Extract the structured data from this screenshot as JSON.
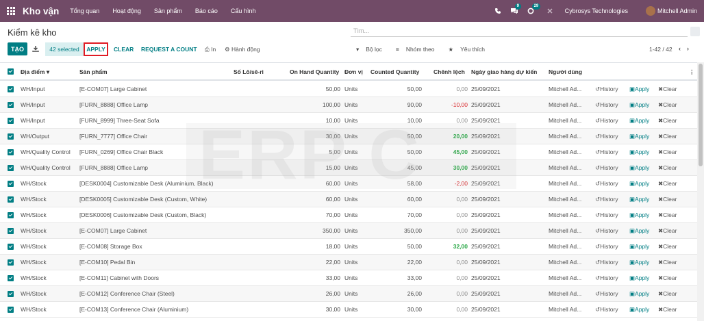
{
  "navbar": {
    "brand": "Kho vận",
    "menu": [
      "Tổng quan",
      "Hoạt động",
      "Sản phẩm",
      "Báo cáo",
      "Cấu hình"
    ],
    "chat_badge": "9",
    "activity_badge": "29",
    "company": "Cybrosys Technologies",
    "user": "Mitchell Admin",
    "color": "#714b67"
  },
  "control": {
    "title": "Kiểm kê kho",
    "search_placeholder": "Tìm...",
    "create": "TẠO",
    "selected": "42 selected",
    "apply": "APPLY",
    "clear": "CLEAR",
    "request_count": "REQUEST A COUNT",
    "print": "In",
    "action": "Hành động",
    "filters": "Bộ lọc",
    "group_by": "Nhóm theo",
    "favorites": "Yêu thích",
    "pager": "1-42 / 42",
    "accent": "#017e84"
  },
  "columns": [
    "Địa điểm",
    "Sản phẩm",
    "Số Lô/sê-ri",
    "On Hand Quantity",
    "Đơn vị",
    "Counted Quantity",
    "Chênh lệch",
    "Ngày giao hàng dự kiến",
    "Người dùng"
  ],
  "row_actions": {
    "history": "History",
    "apply": "Apply",
    "clear": "Clear"
  },
  "rows": [
    {
      "location": "WH/Input",
      "product": "[E-COM07] Large Cabinet",
      "on_hand": "50,00",
      "uom": "Units",
      "counted": "50,00",
      "diff": "0,00",
      "date": "25/09/2021",
      "user": "Mitchell Ad..."
    },
    {
      "location": "WH/Input",
      "product": "[FURN_8888] Office Lamp",
      "on_hand": "100,00",
      "uom": "Units",
      "counted": "90,00",
      "diff": "-10,00",
      "date": "25/09/2021",
      "user": "Mitchell Ad..."
    },
    {
      "location": "WH/Input",
      "product": "[FURN_8999] Three-Seat Sofa",
      "on_hand": "10,00",
      "uom": "Units",
      "counted": "10,00",
      "diff": "0,00",
      "date": "25/09/2021",
      "user": "Mitchell Ad..."
    },
    {
      "location": "WH/Output",
      "product": "[FURN_7777] Office Chair",
      "on_hand": "30,00",
      "uom": "Units",
      "counted": "50,00",
      "diff": "20,00",
      "date": "25/09/2021",
      "user": "Mitchell Ad..."
    },
    {
      "location": "WH/Quality Control",
      "product": "[FURN_0269] Office Chair Black",
      "on_hand": "5,00",
      "uom": "Units",
      "counted": "50,00",
      "diff": "45,00",
      "date": "25/09/2021",
      "user": "Mitchell Ad..."
    },
    {
      "location": "WH/Quality Control",
      "product": "[FURN_8888] Office Lamp",
      "on_hand": "15,00",
      "uom": "Units",
      "counted": "45,00",
      "diff": "30,00",
      "date": "25/09/2021",
      "user": "Mitchell Ad..."
    },
    {
      "location": "WH/Stock",
      "product": "[DESK0004] Customizable Desk (Aluminium, Black)",
      "on_hand": "60,00",
      "uom": "Units",
      "counted": "58,00",
      "diff": "-2,00",
      "date": "25/09/2021",
      "user": "Mitchell Ad..."
    },
    {
      "location": "WH/Stock",
      "product": "[DESK0005] Customizable Desk (Custom, White)",
      "on_hand": "60,00",
      "uom": "Units",
      "counted": "60,00",
      "diff": "0,00",
      "date": "25/09/2021",
      "user": "Mitchell Ad..."
    },
    {
      "location": "WH/Stock",
      "product": "[DESK0006] Customizable Desk (Custom, Black)",
      "on_hand": "70,00",
      "uom": "Units",
      "counted": "70,00",
      "diff": "0,00",
      "date": "25/09/2021",
      "user": "Mitchell Ad..."
    },
    {
      "location": "WH/Stock",
      "product": "[E-COM07] Large Cabinet",
      "on_hand": "350,00",
      "uom": "Units",
      "counted": "350,00",
      "diff": "0,00",
      "date": "25/09/2021",
      "user": "Mitchell Ad..."
    },
    {
      "location": "WH/Stock",
      "product": "[E-COM08] Storage Box",
      "on_hand": "18,00",
      "uom": "Units",
      "counted": "50,00",
      "diff": "32,00",
      "date": "25/09/2021",
      "user": "Mitchell Ad..."
    },
    {
      "location": "WH/Stock",
      "product": "[E-COM10] Pedal Bin",
      "on_hand": "22,00",
      "uom": "Units",
      "counted": "22,00",
      "diff": "0,00",
      "date": "25/09/2021",
      "user": "Mitchell Ad..."
    },
    {
      "location": "WH/Stock",
      "product": "[E-COM11] Cabinet with Doors",
      "on_hand": "33,00",
      "uom": "Units",
      "counted": "33,00",
      "diff": "0,00",
      "date": "25/09/2021",
      "user": "Mitchell Ad..."
    },
    {
      "location": "WH/Stock",
      "product": "[E-COM12] Conference Chair (Steel)",
      "on_hand": "26,00",
      "uom": "Units",
      "counted": "26,00",
      "diff": "0,00",
      "date": "25/09/2021",
      "user": "Mitchell Ad..."
    },
    {
      "location": "WH/Stock",
      "product": "[E-COM13] Conference Chair (Aluminium)",
      "on_hand": "30,00",
      "uom": "Units",
      "counted": "30,00",
      "diff": "0,00",
      "date": "25/09/2021",
      "user": "Mitchell Ad..."
    }
  ]
}
